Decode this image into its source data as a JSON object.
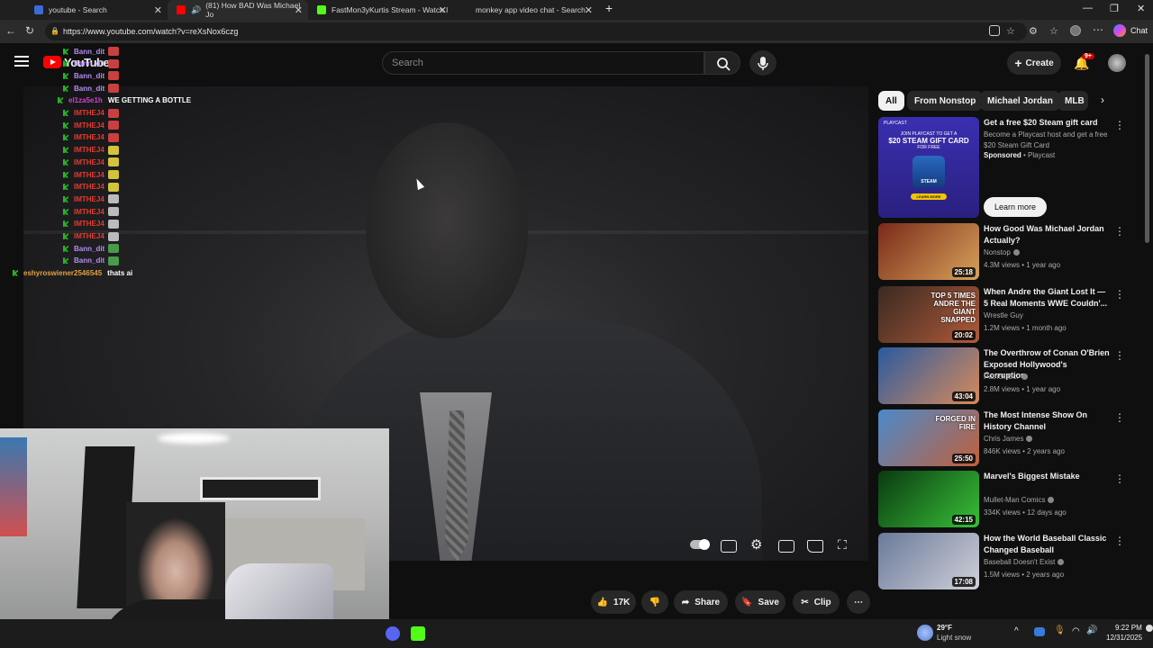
{
  "browser": {
    "tabs": [
      {
        "label": "youtube - Search",
        "color": "#4285f4"
      },
      {
        "label": "(81) How BAD Was Michael Jo",
        "color": "#ff0000"
      },
      {
        "label": "FastMon3yKurtis Stream - Watch l",
        "color": "#53fc18"
      },
      {
        "label": "monkey app video chat - Search",
        "color": "#4285f4"
      }
    ],
    "url": "https://www.youtube.com/watch?v=reXsNox6czg",
    "chat_label": "Chat",
    "new_tab": "+"
  },
  "youtube": {
    "logo": "YouTube",
    "search_placeholder": "Search",
    "create_label": "Create",
    "notif_count": "9+"
  },
  "chat_overlay": [
    {
      "user": "Bann_dit",
      "msg": "",
      "color": "#b38cf0",
      "emote": "#c94040"
    },
    {
      "user": "Bann_dit",
      "msg": "",
      "color": "#b38cf0",
      "emote": "#c94040"
    },
    {
      "user": "Bann_dit",
      "msg": "",
      "color": "#b38cf0",
      "emote": "#c94040"
    },
    {
      "user": "Bann_dit",
      "msg": "",
      "color": "#b38cf0",
      "emote": "#c94040"
    },
    {
      "user": "el1za5e1h",
      "msg": "WE GETTING A BOTTLE",
      "color": "#d23fd2",
      "emote": ""
    },
    {
      "user": "IMTHEJ4",
      "msg": "",
      "color": "#e33b2e",
      "emote": "#c94040"
    },
    {
      "user": "IMTHEJ4",
      "msg": "",
      "color": "#e33b2e",
      "emote": "#c94040"
    },
    {
      "user": "IMTHEJ4",
      "msg": "",
      "color": "#e33b2e",
      "emote": "#c94040"
    },
    {
      "user": "IMTHEJ4",
      "msg": "",
      "color": "#e33b2e",
      "emote": "#d4c23a"
    },
    {
      "user": "IMTHEJ4",
      "msg": "",
      "color": "#e33b2e",
      "emote": "#d4c23a"
    },
    {
      "user": "IMTHEJ4",
      "msg": "",
      "color": "#e33b2e",
      "emote": "#d4c23a"
    },
    {
      "user": "IMTHEJ4",
      "msg": "",
      "color": "#e33b2e",
      "emote": "#d4c23a"
    },
    {
      "user": "IMTHEJ4",
      "msg": "",
      "color": "#e33b2e",
      "emote": "#bbbbbb"
    },
    {
      "user": "IMTHEJ4",
      "msg": "",
      "color": "#e33b2e",
      "emote": "#bbbbbb"
    },
    {
      "user": "IMTHEJ4",
      "msg": "",
      "color": "#e33b2e",
      "emote": "#bbbbbb"
    },
    {
      "user": "IMTHEJ4",
      "msg": "",
      "color": "#e33b2e",
      "emote": "#bbbbbb"
    },
    {
      "user": "Bann_dit",
      "msg": "",
      "color": "#b38cf0",
      "emote": "#4a9a4a"
    },
    {
      "user": "Bann_dit",
      "msg": "",
      "color": "#b38cf0",
      "emote": "#4a9a4a"
    },
    {
      "user": "eshyroswiener2546545",
      "msg": "thats ai",
      "color": "#e0a040",
      "emote": ""
    }
  ],
  "actions": {
    "likes": "17K",
    "share": "Share",
    "save": "Save",
    "clip": "Clip",
    "more": "⋯"
  },
  "chips": [
    "All",
    "From Nonstop",
    "Michael Jordan",
    "MLB"
  ],
  "ad": {
    "title": "Get a free $20 Steam gift card",
    "desc": "Become a Playcast host and get a free $20 Steam Gift Card",
    "sponsored": "Sponsored",
    "advertiser": "Playcast",
    "cta": "Learn more",
    "thumb_top": "PLAYCAST",
    "thumb_line1": "JOIN PLAYCAST TO GET A",
    "thumb_line2": "$20 STEAM GIFT CARD",
    "thumb_line3": "FOR FREE",
    "thumb_steam": "STEAM",
    "thumb_btn": "LEARN MORE"
  },
  "recommendations": [
    {
      "title": "How Good Was Michael Jordan Actually?",
      "channel": "Nonstop",
      "verified": true,
      "meta": "4.3M views • 1 year ago",
      "duration": "25:18",
      "thumb": [
        "#7a2a1a",
        "#d8a25a"
      ],
      "thumb_text": ""
    },
    {
      "title": "When Andre the Giant Lost It — 5 Real Moments WWE Couldn'...",
      "channel": "Wrestle Guy",
      "verified": false,
      "meta": "1.2M views • 1 month ago",
      "duration": "20:02",
      "thumb": [
        "#3a2a22",
        "#b05a3a"
      ],
      "thumb_text": "TOP 5 TIMES ANDRE THE GIANT SNAPPED"
    },
    {
      "title": "The Overthrow of Conan O'Brien Exposed Hollywood's Corruption",
      "channel": "Patrick Cc:",
      "verified": true,
      "meta": "2.8M views • 1 year ago",
      "duration": "43:04",
      "thumb": [
        "#2a5aa0",
        "#d88a5a"
      ],
      "thumb_text": ""
    },
    {
      "title": "The Most Intense Show On History Channel",
      "channel": "Chris James",
      "verified": true,
      "meta": "846K views • 2 years ago",
      "duration": "25:50",
      "thumb": [
        "#4a8acb",
        "#c0603a"
      ],
      "thumb_text": "FORGED IN FIRE"
    },
    {
      "title": "Marvel's Biggest Mistake",
      "channel": "Mullet-Man Comics",
      "verified": true,
      "meta": "334K views • 12 days ago",
      "duration": "42:15",
      "thumb": [
        "#0a3a10",
        "#38c038"
      ],
      "thumb_text": ""
    },
    {
      "title": "How the World Baseball Classic Changed Baseball",
      "channel": "Baseball Doesn't Exist",
      "verified": true,
      "meta": "1.5M views • 2 years ago",
      "duration": "17:08",
      "thumb": [
        "#6a7a9a",
        "#d0d0d8"
      ],
      "thumb_text": ""
    }
  ],
  "taskbar": {
    "temp": "29°F",
    "weather": "Light snow",
    "time": "9:22 PM",
    "date": "12/31/2025"
  }
}
